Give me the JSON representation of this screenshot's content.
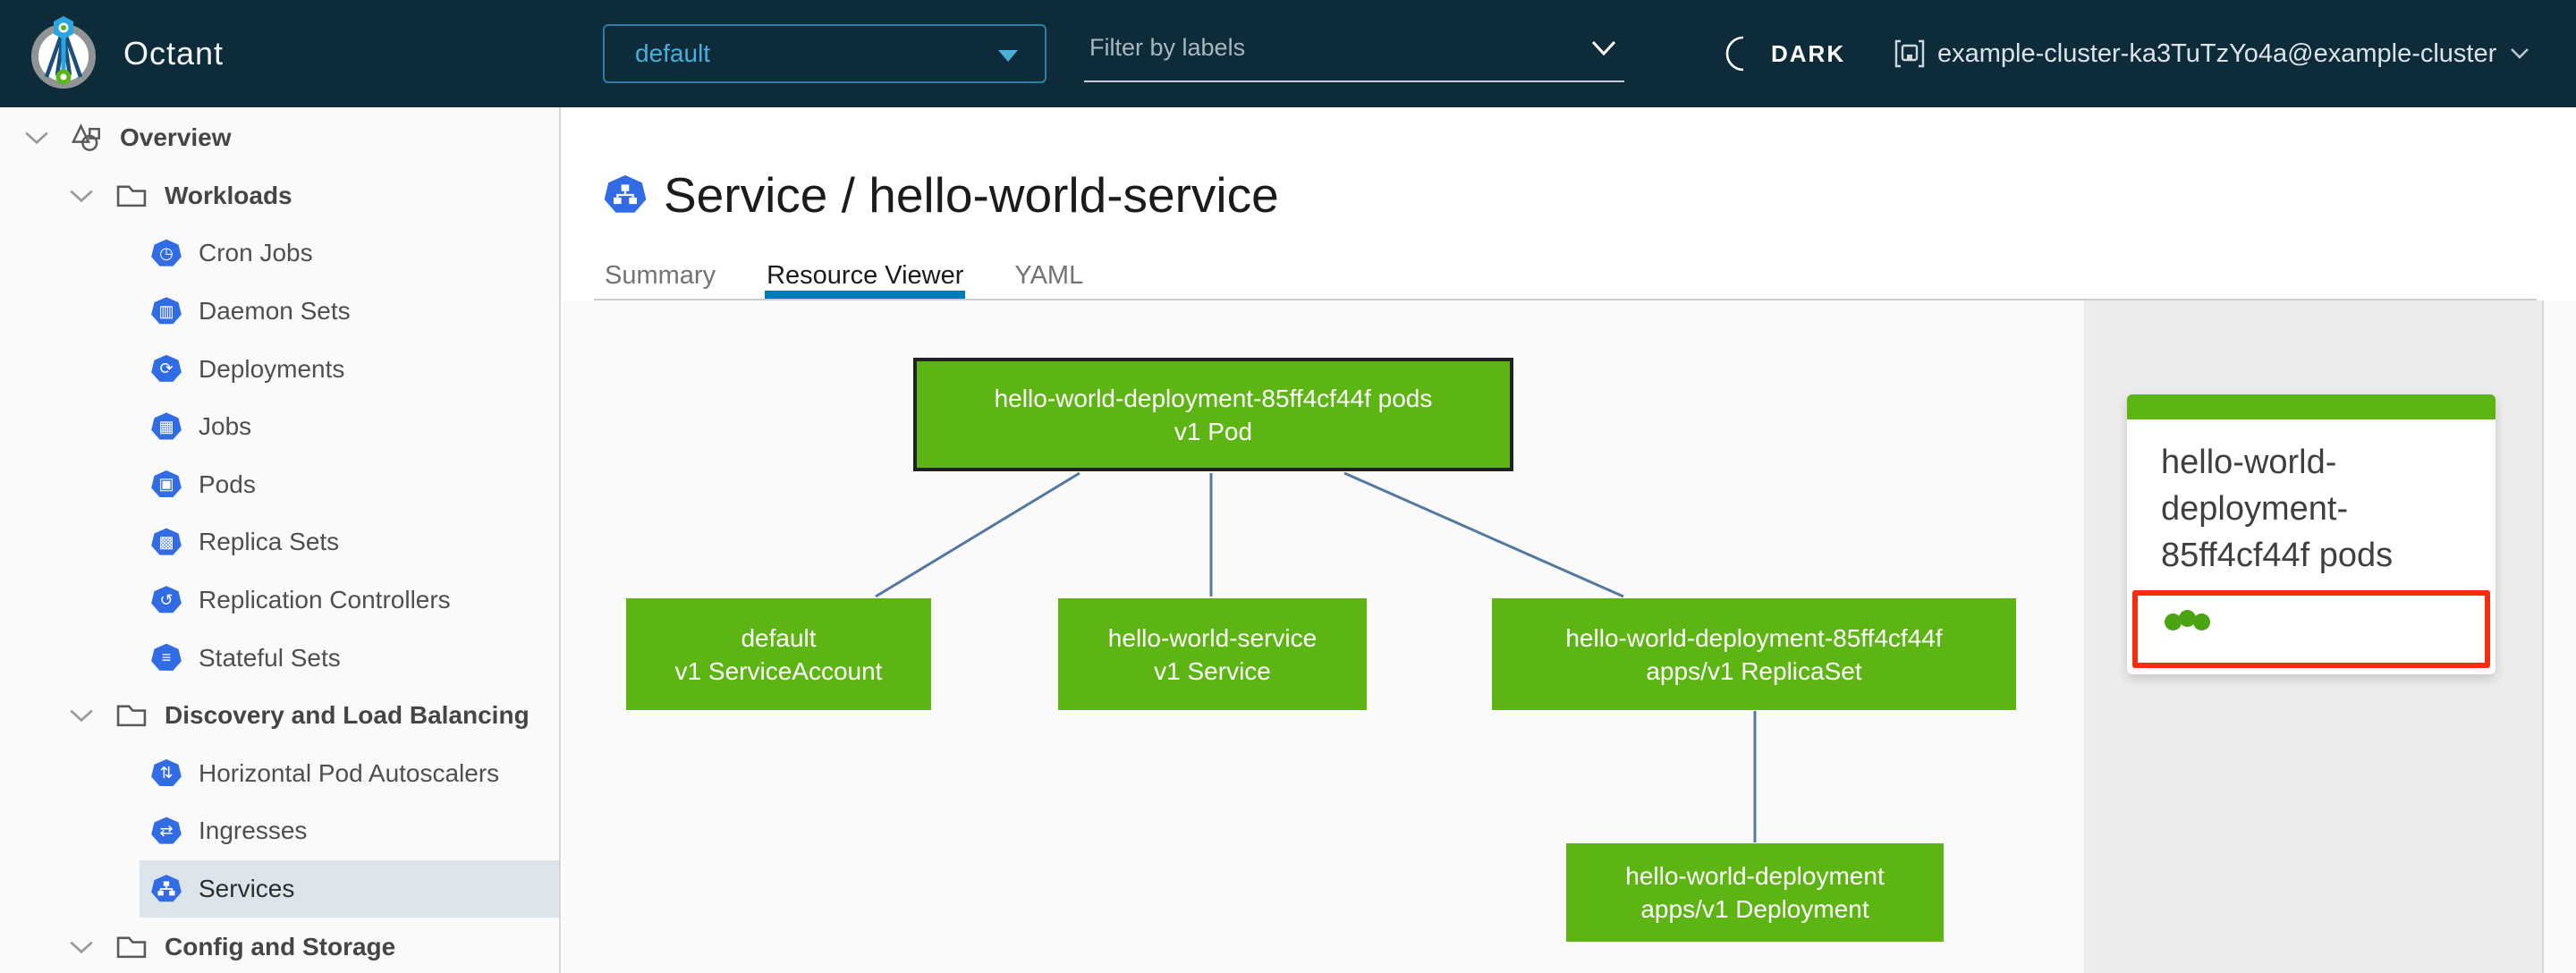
{
  "colors": {
    "header_bg": "#0e2b3a",
    "accent_blue": "#49afd9",
    "tab_active_underline": "#0079b8",
    "k8s_icon_blue": "#326ce5",
    "node_green": "#5db513",
    "edge_color": "#54789e",
    "selection_red": "#f52c0d",
    "sidebar_selected_bg": "#dbe5eb"
  },
  "header": {
    "app_title": "Octant",
    "namespace_select": {
      "value": "default"
    },
    "filter_input": {
      "placeholder": "Filter by labels"
    },
    "theme_toggle": {
      "label": "DARK"
    },
    "cluster_selector": {
      "value": "example-cluster-ka3TuTzYo4a@example-cluster"
    }
  },
  "sidebar": {
    "items": [
      {
        "label": "Overview",
        "icon": "objects",
        "level": 0
      },
      {
        "label": "Workloads",
        "icon": "folder",
        "level": 1
      },
      {
        "label": "Cron Jobs",
        "icon": "cronjob",
        "level": 2
      },
      {
        "label": "Daemon Sets",
        "icon": "daemonset",
        "level": 2
      },
      {
        "label": "Deployments",
        "icon": "deployment",
        "level": 2
      },
      {
        "label": "Jobs",
        "icon": "job",
        "level": 2
      },
      {
        "label": "Pods",
        "icon": "pod",
        "level": 2
      },
      {
        "label": "Replica Sets",
        "icon": "replicaset",
        "level": 2
      },
      {
        "label": "Replication Controllers",
        "icon": "replicationcontroller",
        "level": 2
      },
      {
        "label": "Stateful Sets",
        "icon": "statefulset",
        "level": 2
      },
      {
        "label": "Discovery and Load Balancing",
        "icon": "folder",
        "level": 1
      },
      {
        "label": "Horizontal Pod Autoscalers",
        "icon": "hpa",
        "level": 2
      },
      {
        "label": "Ingresses",
        "icon": "ingress",
        "level": 2
      },
      {
        "label": "Services",
        "icon": "service",
        "level": 2,
        "selected": true
      },
      {
        "label": "Config and Storage",
        "icon": "folder",
        "level": 1
      }
    ]
  },
  "main": {
    "page_title": "Service / hello-world-service",
    "tabs": [
      {
        "label": "Summary",
        "active": false
      },
      {
        "label": "Resource Viewer",
        "active": true
      },
      {
        "label": "YAML",
        "active": false
      }
    ]
  },
  "graph": {
    "nodes": {
      "pod": {
        "name": "hello-world-deployment-85ff4cf44f pods",
        "kind": "v1 Pod",
        "status": "ok",
        "selected": true
      },
      "serviceaccount": {
        "name": "default",
        "kind": "v1 ServiceAccount",
        "status": "ok"
      },
      "service": {
        "name": "hello-world-service",
        "kind": "v1 Service",
        "status": "ok"
      },
      "replicaset": {
        "name": "hello-world-deployment-85ff4cf44f",
        "kind": "apps/v1 ReplicaSet",
        "status": "ok"
      },
      "deployment": {
        "name": "hello-world-deployment",
        "kind": "apps/v1 Deployment",
        "status": "ok"
      }
    }
  },
  "detail_panel": {
    "title": "hello-world-deployment-85ff4cf44f pods",
    "pod_status_dot_count": 3
  },
  "icons": {
    "cronjob": "◷",
    "daemonset": "▥",
    "deployment": "⟳",
    "job": "▦",
    "pod": "▣",
    "replicaset": "▩",
    "replicationcontroller": "↺",
    "statefulset": "≡",
    "hpa": "⇅",
    "ingress": "⇄",
    "service": "sitemap-tree",
    "overview": "objects-outline",
    "group": "folder-outline",
    "theme": "moon-crescent",
    "cluster": "cluster-brackets"
  }
}
